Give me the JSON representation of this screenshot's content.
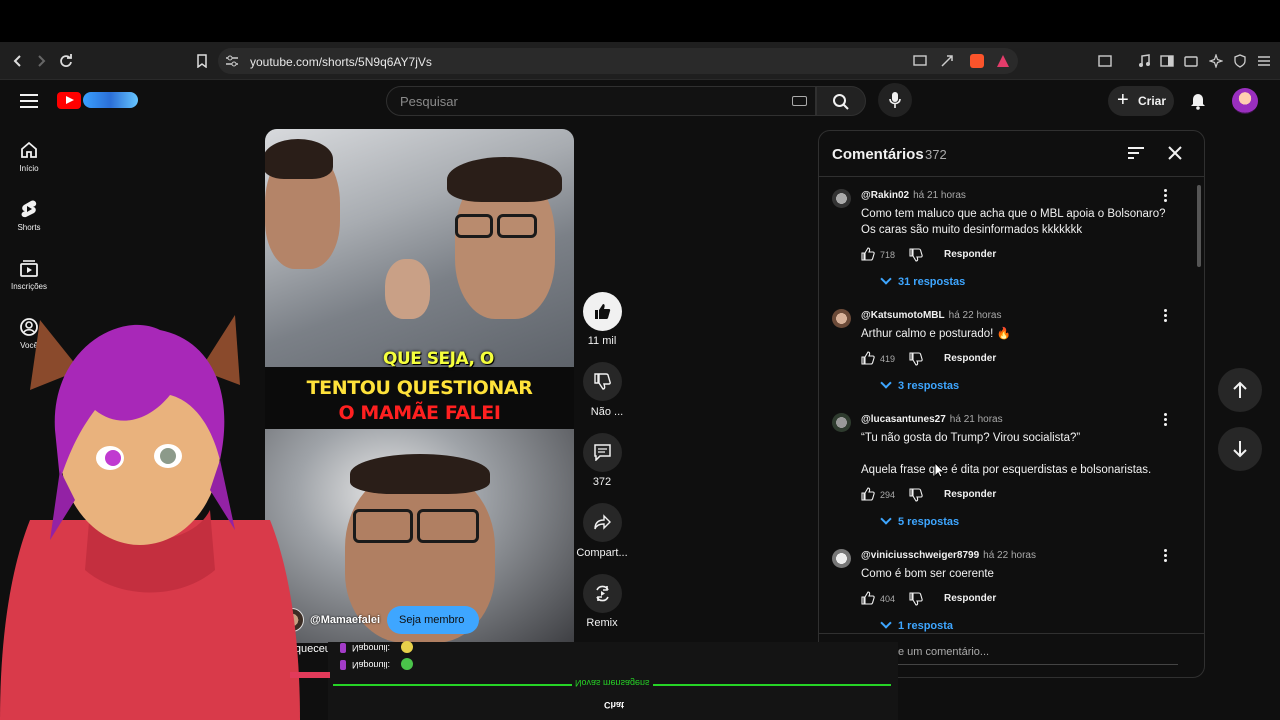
{
  "browser": {
    "url": "youtube.com/shorts/5N9q6AY7jVs"
  },
  "header": {
    "search_placeholder": "Pesquisar",
    "create_label": "Criar"
  },
  "sidebar": {
    "items": [
      {
        "label": "Início",
        "icon": "home-icon"
      },
      {
        "label": "Shorts",
        "icon": "shorts-icon"
      },
      {
        "label": "Inscrições",
        "icon": "subscriptions-icon"
      },
      {
        "label": "Você",
        "icon": "you-icon"
      }
    ]
  },
  "video": {
    "subtitle": "QUE SEJA, O",
    "caption_line1": "TENTOU QUESTIONAR",
    "caption_line2": "O MAMÃE FALEI",
    "channel": "@Mamaefalei",
    "member_button": "Seja membro",
    "description": "Esqueceu"
  },
  "actions": {
    "likes": "11 mil",
    "dislike": "Não ...",
    "comments": "372",
    "share": "Compart...",
    "remix": "Remix"
  },
  "comments": {
    "title": "Comentários",
    "count": "372",
    "reply_label": "Responder",
    "add_placeholder": "e um comentário...",
    "items": [
      {
        "author": "@Rakin02",
        "time": "há 21 horas",
        "text": "Como tem maluco que acha que o MBL apoia o Bolsonaro? Os caras são muito desinformados kkkkkkk",
        "likes": "718",
        "replies": "31 respostas"
      },
      {
        "author": "@KatsumotoMBL",
        "time": "há 22 horas",
        "text": "Arthur calmo e posturado! 🔥",
        "likes": "419",
        "replies": "3 respostas"
      },
      {
        "author": "@lucasantunes27",
        "time": "há 21 horas",
        "text": "“Tu não gosta do Trump? Virou socialista?”",
        "text2": "Aquela frase que é dita por esquerdistas e bolsonaristas.",
        "likes": "294",
        "replies": "5 respostas"
      },
      {
        "author": "@viniciusschweiger8799",
        "time": "há 22 horas",
        "text": "Como é bom ser coerente",
        "likes": "404",
        "replies": "1 resposta"
      }
    ]
  },
  "stream_overlay": {
    "chat_title": "Chat",
    "new_messages": "Novas mensagens",
    "messages": [
      "Naponuil:",
      "Naponuil:"
    ]
  },
  "colors": {
    "background": "#0f0f0f",
    "accent_blue": "#3ea6ff",
    "youtube_red": "#ff0000",
    "chat_green": "#26d426"
  }
}
